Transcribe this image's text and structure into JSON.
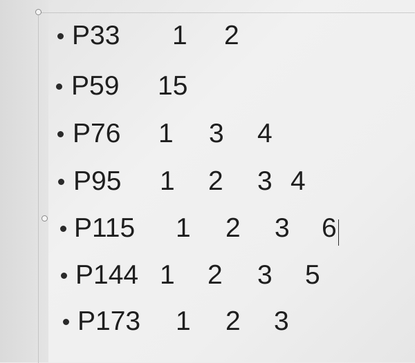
{
  "rows": [
    {
      "page": "P33",
      "nums": [
        "1",
        "2"
      ]
    },
    {
      "page": "P59",
      "nums": [
        "15"
      ]
    },
    {
      "page": "P76",
      "nums": [
        "1",
        "3",
        "4"
      ]
    },
    {
      "page": "P95",
      "nums": [
        "1",
        "2",
        "3",
        "4"
      ]
    },
    {
      "page": "P115",
      "nums": [
        "1",
        "2",
        "3",
        "6"
      ]
    },
    {
      "page": "P144",
      "nums": [
        "1",
        "2",
        "3",
        "5"
      ]
    },
    {
      "page": "P173",
      "nums": [
        "1",
        "2",
        "3"
      ]
    }
  ]
}
